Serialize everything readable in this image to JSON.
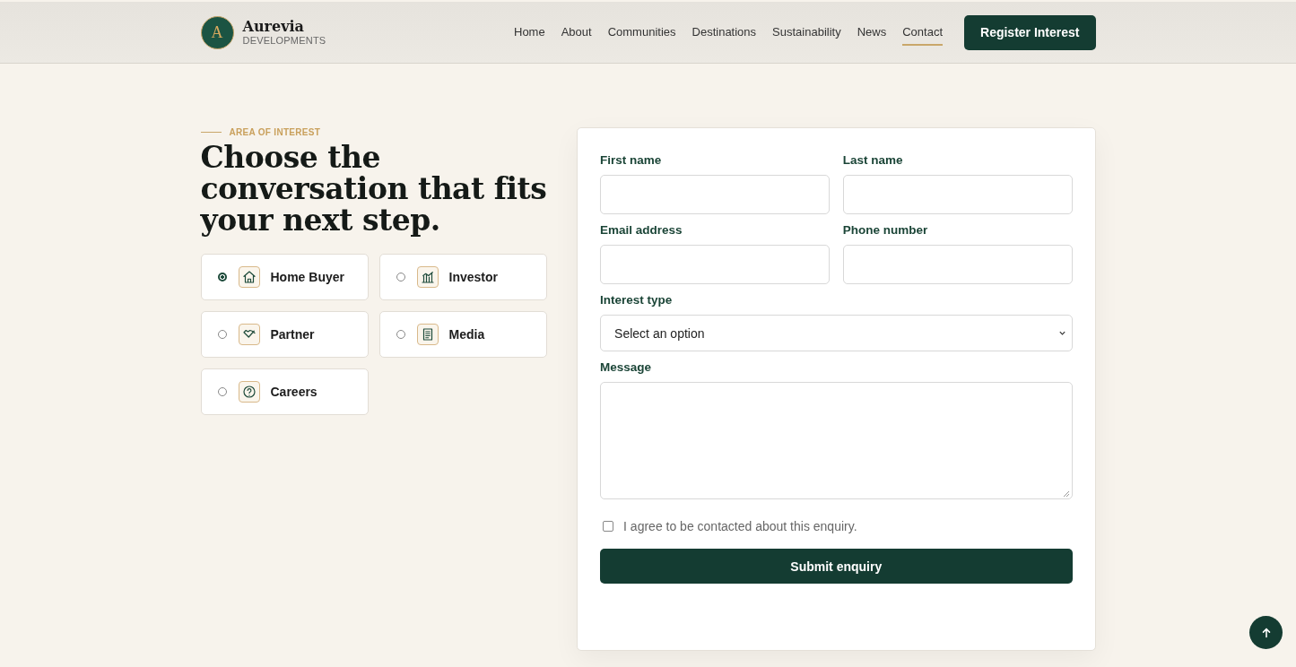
{
  "brand": {
    "mark": "A",
    "name": "Aurevia",
    "tagline": "DEVELOPMENTS"
  },
  "nav": [
    {
      "label": "Home",
      "selected": false
    },
    {
      "label": "About",
      "selected": false
    },
    {
      "label": "Communities",
      "selected": false
    },
    {
      "label": "Destinations",
      "selected": false
    },
    {
      "label": "Sustainability",
      "selected": false
    },
    {
      "label": "News",
      "selected": false
    },
    {
      "label": "Contact",
      "selected": true
    }
  ],
  "cta": "Register Interest",
  "eyebrow": "AREA OF INTEREST",
  "heading": "Choose the conversation that fits your next step.",
  "options": [
    {
      "label": "Home Buyer",
      "selected": true
    },
    {
      "label": "Investor",
      "selected": false
    },
    {
      "label": "Partner",
      "selected": false
    },
    {
      "label": "Media",
      "selected": false
    },
    {
      "label": "Careers",
      "selected": false
    }
  ],
  "form": {
    "fields": [
      {
        "label": "First name",
        "kind": "text"
      },
      {
        "label": "Last name",
        "kind": "text"
      },
      {
        "label": "Email address",
        "kind": "text"
      },
      {
        "label": "Phone number",
        "kind": "text"
      },
      {
        "label": "Interest type",
        "kind": "select",
        "value": "Select an option"
      },
      {
        "label": "Message",
        "kind": "textarea"
      }
    ],
    "consent": {
      "label": "I agree to be contacted about this enquiry.",
      "checked": false
    },
    "submit": "Submit enquiry"
  }
}
